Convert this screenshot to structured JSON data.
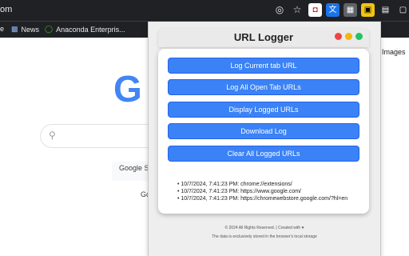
{
  "browser": {
    "url_fragment": "om",
    "bookmarks": [
      {
        "label": "e"
      },
      {
        "label": "News"
      },
      {
        "label": "Anaconda Enterpris..."
      }
    ]
  },
  "google": {
    "logo_letter": "G",
    "button_label": "Google S",
    "partial_text": "Go",
    "images_link": "Images"
  },
  "popup": {
    "title": "URL Logger",
    "buttons": [
      {
        "label": "Log Current tab URL"
      },
      {
        "label": "Log All Open Tab URLs"
      },
      {
        "label": "Display Logged URLs"
      },
      {
        "label": "Download Log"
      },
      {
        "label": "Clear All Logged URLs"
      }
    ],
    "log_entries": [
      "10/7/2024, 7:41:23 PM: chrome://extensions/",
      "10/7/2024, 7:41:23 PM: https://www.google.com/",
      "10/7/2024, 7:41:23 PM: https://chromewebstore.google.com/?hl=en"
    ],
    "footer_copyright": "© 2024 All Rights Reserved. | Created with ♥",
    "footer_note": "The data is exclusively stored in the browser's local storage",
    "colors": {
      "accent": "#3b82f6",
      "dot_red": "#ef4444",
      "dot_yellow": "#f5b60b",
      "dot_green": "#22c55e"
    }
  }
}
